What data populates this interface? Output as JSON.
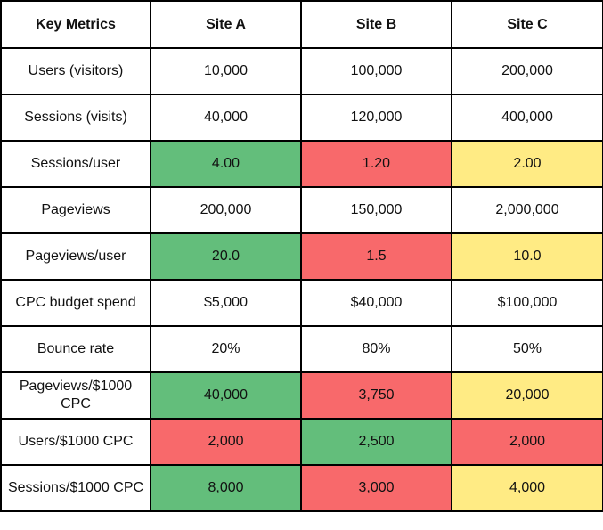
{
  "table": {
    "headers": [
      "Key Metrics",
      "Site A",
      "Site B",
      "Site C"
    ],
    "colors": {
      "good": "#63BE7B",
      "bad": "#F8696B",
      "mid": "#FFEB84",
      "none": "#FFFFFF"
    },
    "rows": [
      {
        "metric": "Users (visitors)",
        "values": [
          "10,000",
          "100,000",
          "200,000"
        ],
        "ratings": [
          "none",
          "none",
          "none"
        ]
      },
      {
        "metric": "Sessions (visits)",
        "values": [
          "40,000",
          "120,000",
          "400,000"
        ],
        "ratings": [
          "none",
          "none",
          "none"
        ]
      },
      {
        "metric": "Sessions/user",
        "values": [
          "4.00",
          "1.20",
          "2.00"
        ],
        "ratings": [
          "good",
          "bad",
          "mid"
        ]
      },
      {
        "metric": "Pageviews",
        "values": [
          "200,000",
          "150,000",
          "2,000,000"
        ],
        "ratings": [
          "none",
          "none",
          "none"
        ]
      },
      {
        "metric": "Pageviews/user",
        "values": [
          "20.0",
          "1.5",
          "10.0"
        ],
        "ratings": [
          "good",
          "bad",
          "mid"
        ]
      },
      {
        "metric": "CPC budget spend",
        "values": [
          "$5,000",
          "$40,000",
          "$100,000"
        ],
        "ratings": [
          "none",
          "none",
          "none"
        ]
      },
      {
        "metric": "Bounce rate",
        "values": [
          "20%",
          "80%",
          "50%"
        ],
        "ratings": [
          "none",
          "none",
          "none"
        ]
      },
      {
        "metric": "Pageviews/$1000 CPC",
        "values": [
          "40,000",
          "3,750",
          "20,000"
        ],
        "ratings": [
          "good",
          "bad",
          "mid"
        ]
      },
      {
        "metric": "Users/$1000 CPC",
        "values": [
          "2,000",
          "2,500",
          "2,000"
        ],
        "ratings": [
          "bad",
          "good",
          "bad"
        ]
      },
      {
        "metric": "Sessions/$1000 CPC",
        "values": [
          "8,000",
          "3,000",
          "4,000"
        ],
        "ratings": [
          "good",
          "bad",
          "mid"
        ]
      }
    ]
  }
}
